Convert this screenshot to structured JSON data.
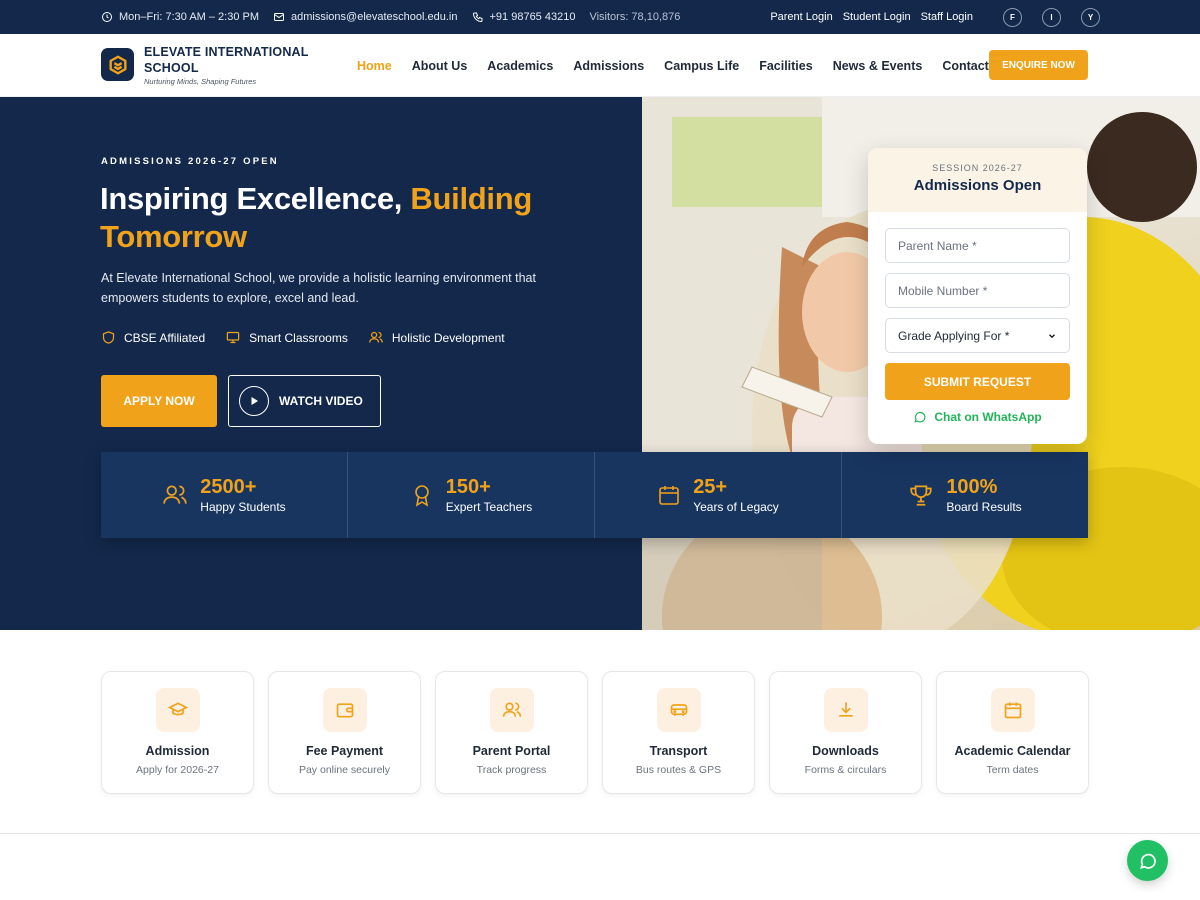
{
  "topbar": {
    "hours": "Mon–Fri: 7:30 AM – 2:30 PM",
    "email": "admissions@elevateschool.edu.in",
    "phone": "+91 98765 43210",
    "visitors": "Visitors: 78,10,876",
    "logins": [
      "Parent Login",
      "Student Login",
      "Staff Login"
    ],
    "social": [
      "F",
      "I",
      "Y"
    ]
  },
  "brand": {
    "name": "ELEVATE INTERNATIONAL SCHOOL",
    "tagline": "Nurturing Minds, Shaping Futures"
  },
  "nav": {
    "items": [
      "Home",
      "About Us",
      "Academics",
      "Admissions",
      "Campus Life",
      "Facilities",
      "News & Events",
      "Contact Us"
    ],
    "active": "Home",
    "cta": "ENQUIRE NOW"
  },
  "hero": {
    "eyebrow": "ADMISSIONS 2026-27 OPEN",
    "title_main": "Inspiring Excellence, ",
    "title_highlight": "Building Tomorrow",
    "lead": "At Elevate International School, we provide a holistic learning environment that empowers students to explore, excel and lead.",
    "features": [
      {
        "icon": "shield-icon",
        "label": "CBSE Affiliated"
      },
      {
        "icon": "monitor-icon",
        "label": "Smart Classrooms"
      },
      {
        "icon": "users-icon",
        "label": "Holistic Development"
      }
    ],
    "apply_label": "APPLY NOW",
    "video_label": "WATCH VIDEO"
  },
  "stats": [
    {
      "icon": "users-icon",
      "value": "2500+",
      "label": "Happy Students"
    },
    {
      "icon": "award-icon",
      "value": "150+",
      "label": "Expert Teachers"
    },
    {
      "icon": "calendar-icon",
      "value": "25+",
      "label": "Years of Legacy"
    },
    {
      "icon": "trophy-icon",
      "value": "100%",
      "label": "Board Results"
    }
  ],
  "form": {
    "session": "SESSION 2026-27",
    "title": "Admissions Open",
    "parent_placeholder": "Parent Name *",
    "mobile_placeholder": "Mobile Number *",
    "grade_value": "Grade Applying For *",
    "submit": "SUBMIT REQUEST",
    "whatsapp": "Chat on WhatsApp"
  },
  "quick_links": [
    {
      "icon": "graduation-cap-icon",
      "title": "Admission",
      "sub": "Apply for 2026-27"
    },
    {
      "icon": "wallet-icon",
      "title": "Fee Payment",
      "sub": "Pay online securely"
    },
    {
      "icon": "users-icon",
      "title": "Parent Portal",
      "sub": "Track progress"
    },
    {
      "icon": "bus-icon",
      "title": "Transport",
      "sub": "Bus routes & GPS"
    },
    {
      "icon": "download-icon",
      "title": "Downloads",
      "sub": "Forms & circulars"
    },
    {
      "icon": "calendar-icon",
      "title": "Academic Calendar",
      "sub": "Term dates"
    }
  ],
  "colors": {
    "navy": "#13284b",
    "accent": "#f0a21a",
    "whatsapp": "#22c064"
  }
}
